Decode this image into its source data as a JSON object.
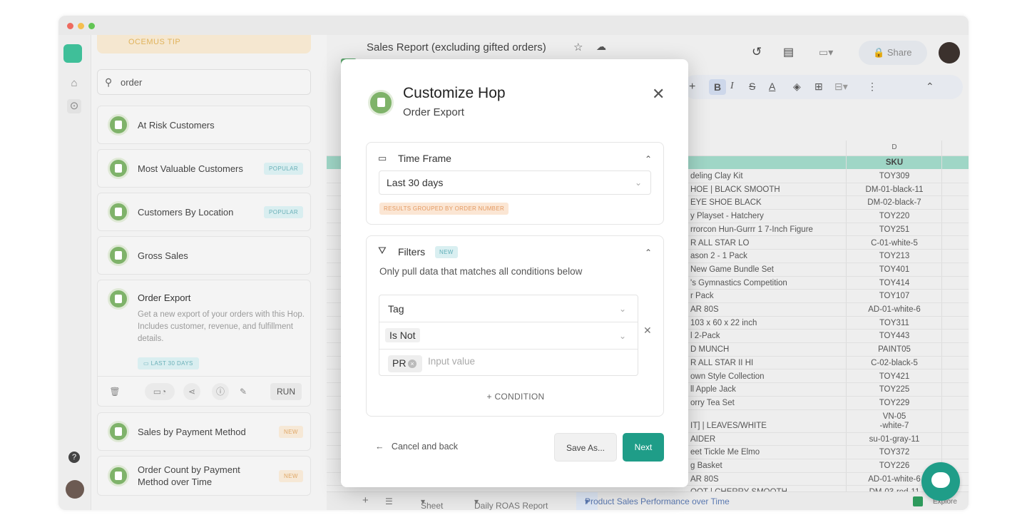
{
  "window": {
    "dots": [
      "#ee6a5f",
      "#f5be4f",
      "#62c554"
    ]
  },
  "hop_panel": {
    "tip": "OCEMUS TIP",
    "search_value": "order",
    "cards": [
      {
        "name": "At Risk Customers",
        "badge": ""
      },
      {
        "name": "Most Valuable Customers",
        "badge": "POPULAR"
      },
      {
        "name": "Customers By Location",
        "badge": "POPULAR"
      },
      {
        "name": "Gross Sales",
        "badge": ""
      }
    ],
    "expanded": {
      "name": "Order Export",
      "description": "Get a new export of your orders with this Hop. Includes customer, revenue, and fulfillment details.",
      "date_badge": "LAST 30 DAYS",
      "run_label": "RUN"
    },
    "cards_below": [
      {
        "name": "Sales by Payment Method",
        "badge": "NEW"
      },
      {
        "name": "Order Count by Payment\nMethod over Time",
        "badge": "NEW"
      }
    ]
  },
  "sheet": {
    "title": "Sales Report (excluding gifted orders)",
    "share_label": "Share",
    "col_letter": "D",
    "header_sku": "SKU",
    "rows": [
      [
        "deling Clay Kit",
        "TOY309"
      ],
      [
        "HOE | BLACK SMOOTH",
        "DM-01-black-11"
      ],
      [
        "EYE SHOE BLACK",
        "DM-02-black-7"
      ],
      [
        "y Playset - Hatchery",
        "TOY220"
      ],
      [
        "rrorcon Hun-Gurrr 1 7-Inch Figure",
        "TOY251"
      ],
      [
        "R ALL STAR LO",
        "C-01-white-5"
      ],
      [
        "ason 2 - 1 Pack",
        "TOY213"
      ],
      [
        "New Game Bundle Set",
        "TOY401"
      ],
      [
        "'s Gymnastics Competition",
        "TOY414"
      ],
      [
        "r Pack",
        "TOY107"
      ],
      [
        "AR 80S",
        "AD-01-white-6"
      ],
      [
        "103 x 60 x 22 inch",
        "TOY311"
      ],
      [
        "l 2-Pack",
        "TOY443"
      ],
      [
        "D MUNCH",
        "PAINT05"
      ],
      [
        "R ALL STAR II HI",
        "C-02-black-5"
      ],
      [
        "own Style Collection",
        "TOY421"
      ],
      [
        "ll Apple Jack",
        "TOY225"
      ],
      [
        "orry Tea Set",
        "TOY229"
      ],
      [
        "IT] | LEAVES/WHITE",
        "VN-05\n-white-7"
      ],
      [
        "AIDER",
        "su-01-gray-11"
      ],
      [
        "eet Tickle Me Elmo",
        "TOY372"
      ],
      [
        "g Basket",
        "TOY226"
      ],
      [
        "AR 80S",
        "AD-01-white-6"
      ],
      [
        "OOT | CHERRY SMOOTH",
        "DM-03-red-11"
      ]
    ],
    "tabs": [
      "Sheet",
      "Daily ROAS Report",
      "Product Sales Performance over Time"
    ],
    "explore_label": "Explore"
  },
  "modal": {
    "title": "Customize Hop",
    "subtitle": "Order Export",
    "time_frame": {
      "heading": "Time Frame",
      "value": "Last 30 days",
      "note": "RESULTS GROUPED BY ORDER NUMBER"
    },
    "filters": {
      "heading": "Filters",
      "badge": "NEW",
      "hint": "Only pull data that matches all conditions below",
      "field": "Tag",
      "operator": "Is Not",
      "chip": "PR",
      "input_placeholder": "Input value",
      "add_condition": "+ CONDITION"
    },
    "cancel_label": "Cancel and back",
    "save_as_label": "Save As...",
    "next_label": "Next"
  },
  "colors": {
    "accent": "#1f9d88",
    "shopify_green": "#7fb36a",
    "popular": "#6ab0b8",
    "new_badge": "#e0a868"
  }
}
